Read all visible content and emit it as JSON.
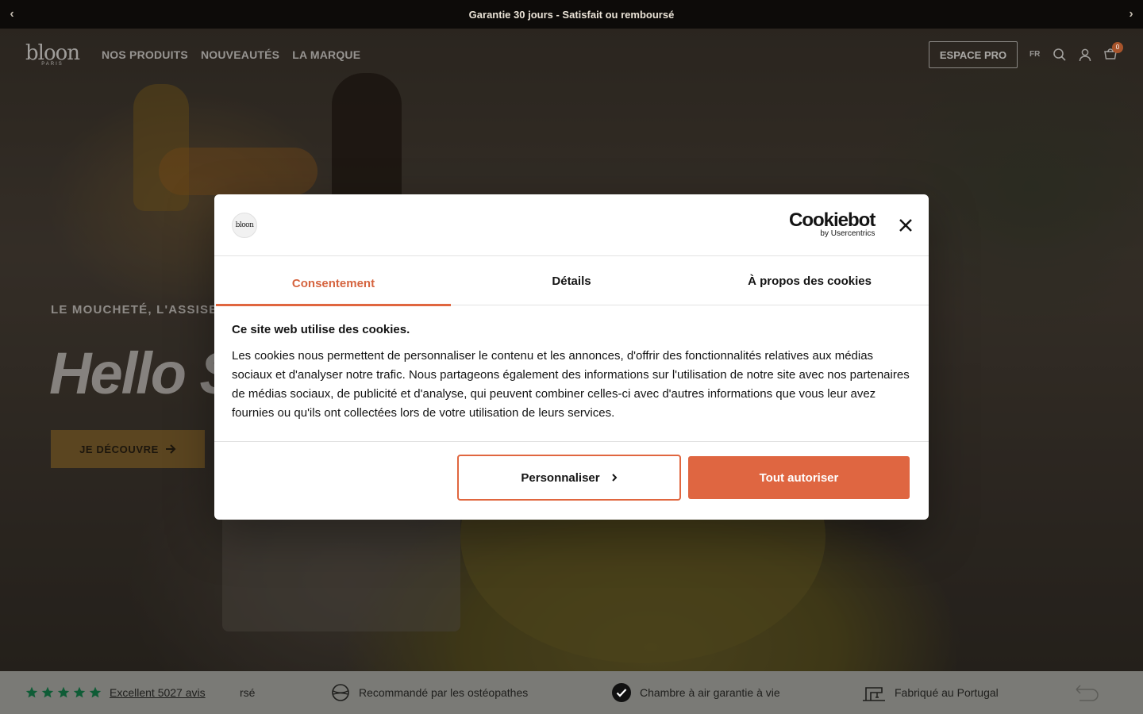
{
  "announcement": {
    "text": "Garantie 30 jours - Satisfait ou remboursé",
    "prev_icon": "chevron-left-icon",
    "next_icon": "chevron-right-icon"
  },
  "header": {
    "logo_text": "bloon",
    "logo_sub": "PARIS",
    "nav": [
      "NOS PRODUITS",
      "NOUVEAUTÉS",
      "LA MARQUE"
    ],
    "pro_button": "ESPACE PRO",
    "lang": "FR",
    "cart_count": "0"
  },
  "hero": {
    "eyebrow": "LE MOUCHETÉ, L'ASSISE DE",
    "headline": "Hello S",
    "cta_label": "JE DÉCOUVRE"
  },
  "strip": {
    "rating_label": "Excellent 5027 avis",
    "faded_text": "rsé",
    "items": [
      "Recommandé par les ostéopathes",
      "Chambre à air garantie à vie",
      "Fabriqué au Portugal"
    ]
  },
  "cookie_modal": {
    "brand_badge": "bloon",
    "provider_main": "Cookiebot",
    "provider_sub": "by Usercentrics",
    "tabs": [
      "Consentement",
      "Détails",
      "À propos des cookies"
    ],
    "active_tab": 0,
    "heading": "Ce site web utilise des cookies.",
    "body": "Les cookies nous permettent de personnaliser le contenu et les annonces, d'offrir des fonctionnalités relatives aux médias sociaux et d'analyser notre trafic. Nous partageons également des informations sur l'utilisation de notre site avec nos partenaires de médias sociaux, de publicité et d'analyse, qui peuvent combiner celles-ci avec d'autres informations que vous leur avez fournies ou qu'ils ont collectées lors de votre utilisation de leurs services.",
    "customize_label": "Personnaliser",
    "allow_label": "Tout autoriser"
  },
  "colors": {
    "accent": "#df6641",
    "announcement_bg": "#0d0b09",
    "strip_bg": "#7a7a76"
  }
}
